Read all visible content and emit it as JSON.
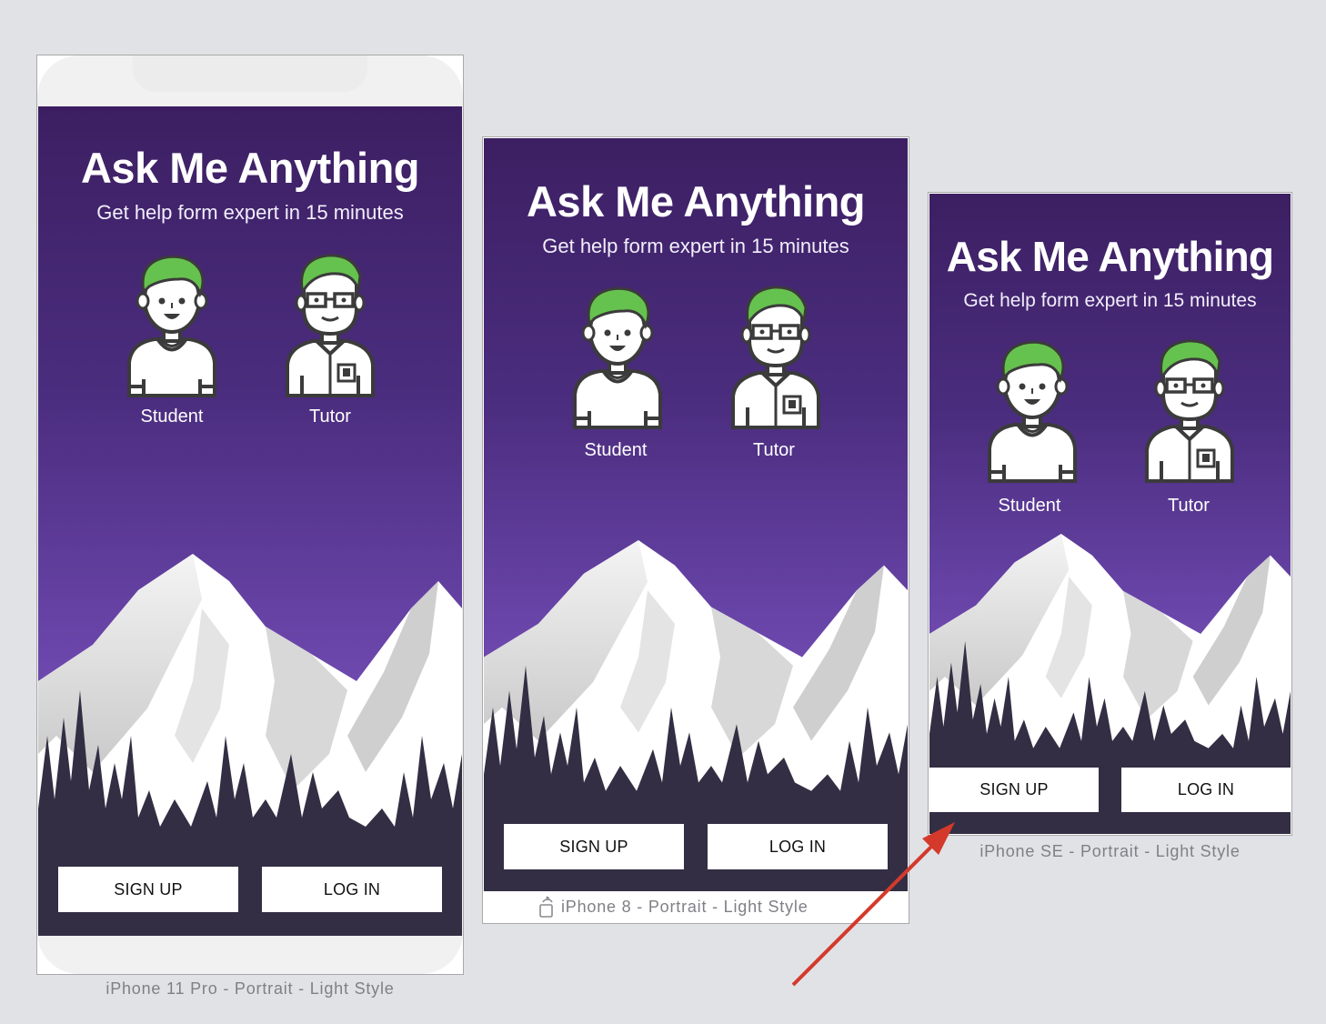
{
  "app": {
    "title": "Ask Me Anything",
    "subtitle": "Get help form expert in 15 minutes",
    "roles": [
      {
        "label": "Student",
        "icon": "student-avatar-icon"
      },
      {
        "label": "Tutor",
        "icon": "tutor-avatar-icon"
      }
    ],
    "buttons": {
      "signup": "SIGN UP",
      "login": "LOG IN"
    }
  },
  "devices": [
    {
      "caption": "iPhone 11 Pro - Portrait - Light Style"
    },
    {
      "caption": "iPhone 8 - Portrait - Light Style",
      "icon": "rotate-device-icon"
    },
    {
      "caption": "iPhone SE - Portrait - Light Style"
    }
  ],
  "colors": {
    "gradient_top": "#3c1f62",
    "gradient_bottom": "#7a55b8",
    "forest": "#332e43",
    "hair": "#66c24e",
    "annotation_arrow": "#d33a2c"
  }
}
